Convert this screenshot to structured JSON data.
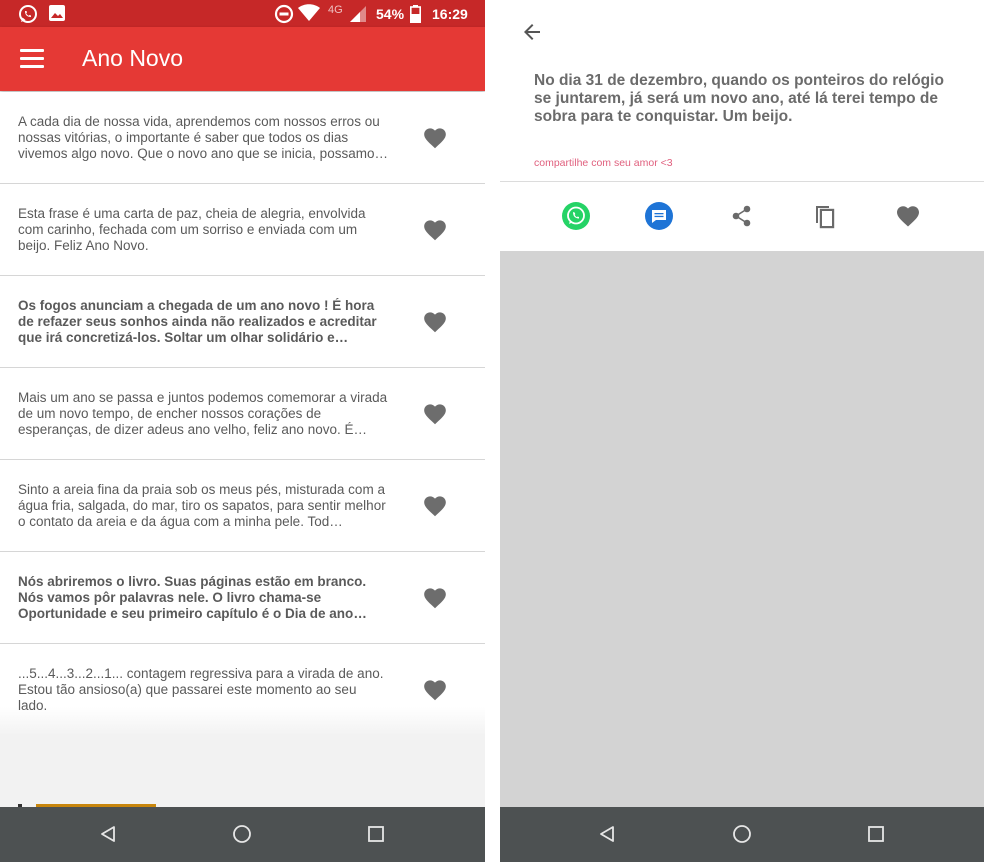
{
  "status_bar": {
    "network": "4G",
    "battery": "54%",
    "time": "16:29"
  },
  "app_bar": {
    "title": "Ano Novo"
  },
  "quotes": [
    {
      "text": "A cada dia de nossa vida, aprendemos com nossos erros ou nossas vitórias, o importante é saber que todos os dias vivemos algo novo. Que o novo ano que se inicia, possamo…",
      "bold": false
    },
    {
      "text": "Esta frase é uma carta de paz, cheia de alegria, envolvida com carinho, fechada com um sorriso e enviada com um beijo. Feliz Ano Novo.",
      "bold": false
    },
    {
      "text": "Os fogos anunciam a chegada de um ano novo ! É hora de refazer seus sonhos ainda não realizados e acreditar que irá concretizá-los. Soltar um olhar solidário e acalantador para…",
      "bold": true
    },
    {
      "text": "Mais um ano se passa e juntos podemos comemorar a virada de um novo tempo, de encher nossos corações de esperanças, de dizer adeus ano velho, feliz ano novo. É mui…",
      "bold": false
    },
    {
      "text": "Sinto a areia fina da praia sob os meus pés, misturada com a água fria, salgada, do mar, tiro os sapatos, para sentir melhor o contato da areia e da água com a minha pele. Tod…",
      "bold": false
    },
    {
      "text": "Nós abriremos o livro. Suas páginas estão em branco. Nós vamos pôr palavras nele. O livro chama-se Oportunidade e seu primeiro capítulo é o Dia de ano novo.",
      "bold": true
    },
    {
      "text": "...5...4...3...2...1... contagem regressiva para a virada de ano. Estou tão ansioso(a) que passarei este momento ao seu lado.",
      "bold": false
    }
  ],
  "detail": {
    "quote": "No dia 31 de dezembro, quando os ponteiros do relógio se juntarem, já será um novo ano, até lá terei tempo de sobra para te conquistar. Um beijo.",
    "share_note": "compartilhe com seu amor <3"
  },
  "colors": {
    "status_bar": "#c62828",
    "app_bar": "#e53935",
    "heart": "#6d6d6d",
    "whatsapp": "#25d366",
    "messages": "#1e74d6",
    "share_note": "#e0607e",
    "nav_bar": "#4d5152"
  },
  "icons": {
    "menu": "hamburger-icon",
    "favorite": "heart-icon",
    "back": "arrow-left-icon",
    "actions": [
      "whatsapp-icon",
      "messages-icon",
      "share-icon",
      "copy-icon",
      "heart-icon"
    ],
    "nav": [
      "back-triangle-icon",
      "home-circle-icon",
      "recents-square-icon"
    ]
  }
}
